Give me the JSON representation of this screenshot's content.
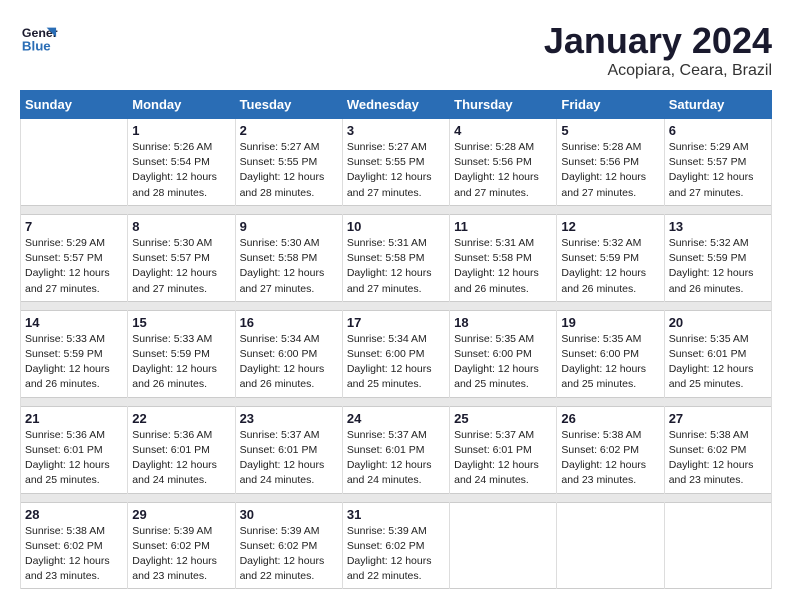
{
  "header": {
    "logo_line1": "General",
    "logo_line2": "Blue",
    "main_title": "January 2024",
    "subtitle": "Acopiara, Ceara, Brazil"
  },
  "days_of_week": [
    "Sunday",
    "Monday",
    "Tuesday",
    "Wednesday",
    "Thursday",
    "Friday",
    "Saturday"
  ],
  "weeks": [
    [
      {
        "day": "",
        "info": ""
      },
      {
        "day": "1",
        "info": "Sunrise: 5:26 AM\nSunset: 5:54 PM\nDaylight: 12 hours\nand 28 minutes."
      },
      {
        "day": "2",
        "info": "Sunrise: 5:27 AM\nSunset: 5:55 PM\nDaylight: 12 hours\nand 28 minutes."
      },
      {
        "day": "3",
        "info": "Sunrise: 5:27 AM\nSunset: 5:55 PM\nDaylight: 12 hours\nand 27 minutes."
      },
      {
        "day": "4",
        "info": "Sunrise: 5:28 AM\nSunset: 5:56 PM\nDaylight: 12 hours\nand 27 minutes."
      },
      {
        "day": "5",
        "info": "Sunrise: 5:28 AM\nSunset: 5:56 PM\nDaylight: 12 hours\nand 27 minutes."
      },
      {
        "day": "6",
        "info": "Sunrise: 5:29 AM\nSunset: 5:57 PM\nDaylight: 12 hours\nand 27 minutes."
      }
    ],
    [
      {
        "day": "7",
        "info": "Sunrise: 5:29 AM\nSunset: 5:57 PM\nDaylight: 12 hours\nand 27 minutes."
      },
      {
        "day": "8",
        "info": "Sunrise: 5:30 AM\nSunset: 5:57 PM\nDaylight: 12 hours\nand 27 minutes."
      },
      {
        "day": "9",
        "info": "Sunrise: 5:30 AM\nSunset: 5:58 PM\nDaylight: 12 hours\nand 27 minutes."
      },
      {
        "day": "10",
        "info": "Sunrise: 5:31 AM\nSunset: 5:58 PM\nDaylight: 12 hours\nand 27 minutes."
      },
      {
        "day": "11",
        "info": "Sunrise: 5:31 AM\nSunset: 5:58 PM\nDaylight: 12 hours\nand 26 minutes."
      },
      {
        "day": "12",
        "info": "Sunrise: 5:32 AM\nSunset: 5:59 PM\nDaylight: 12 hours\nand 26 minutes."
      },
      {
        "day": "13",
        "info": "Sunrise: 5:32 AM\nSunset: 5:59 PM\nDaylight: 12 hours\nand 26 minutes."
      }
    ],
    [
      {
        "day": "14",
        "info": "Sunrise: 5:33 AM\nSunset: 5:59 PM\nDaylight: 12 hours\nand 26 minutes."
      },
      {
        "day": "15",
        "info": "Sunrise: 5:33 AM\nSunset: 5:59 PM\nDaylight: 12 hours\nand 26 minutes."
      },
      {
        "day": "16",
        "info": "Sunrise: 5:34 AM\nSunset: 6:00 PM\nDaylight: 12 hours\nand 26 minutes."
      },
      {
        "day": "17",
        "info": "Sunrise: 5:34 AM\nSunset: 6:00 PM\nDaylight: 12 hours\nand 25 minutes."
      },
      {
        "day": "18",
        "info": "Sunrise: 5:35 AM\nSunset: 6:00 PM\nDaylight: 12 hours\nand 25 minutes."
      },
      {
        "day": "19",
        "info": "Sunrise: 5:35 AM\nSunset: 6:00 PM\nDaylight: 12 hours\nand 25 minutes."
      },
      {
        "day": "20",
        "info": "Sunrise: 5:35 AM\nSunset: 6:01 PM\nDaylight: 12 hours\nand 25 minutes."
      }
    ],
    [
      {
        "day": "21",
        "info": "Sunrise: 5:36 AM\nSunset: 6:01 PM\nDaylight: 12 hours\nand 25 minutes."
      },
      {
        "day": "22",
        "info": "Sunrise: 5:36 AM\nSunset: 6:01 PM\nDaylight: 12 hours\nand 24 minutes."
      },
      {
        "day": "23",
        "info": "Sunrise: 5:37 AM\nSunset: 6:01 PM\nDaylight: 12 hours\nand 24 minutes."
      },
      {
        "day": "24",
        "info": "Sunrise: 5:37 AM\nSunset: 6:01 PM\nDaylight: 12 hours\nand 24 minutes."
      },
      {
        "day": "25",
        "info": "Sunrise: 5:37 AM\nSunset: 6:01 PM\nDaylight: 12 hours\nand 24 minutes."
      },
      {
        "day": "26",
        "info": "Sunrise: 5:38 AM\nSunset: 6:02 PM\nDaylight: 12 hours\nand 23 minutes."
      },
      {
        "day": "27",
        "info": "Sunrise: 5:38 AM\nSunset: 6:02 PM\nDaylight: 12 hours\nand 23 minutes."
      }
    ],
    [
      {
        "day": "28",
        "info": "Sunrise: 5:38 AM\nSunset: 6:02 PM\nDaylight: 12 hours\nand 23 minutes."
      },
      {
        "day": "29",
        "info": "Sunrise: 5:39 AM\nSunset: 6:02 PM\nDaylight: 12 hours\nand 23 minutes."
      },
      {
        "day": "30",
        "info": "Sunrise: 5:39 AM\nSunset: 6:02 PM\nDaylight: 12 hours\nand 22 minutes."
      },
      {
        "day": "31",
        "info": "Sunrise: 5:39 AM\nSunset: 6:02 PM\nDaylight: 12 hours\nand 22 minutes."
      },
      {
        "day": "",
        "info": ""
      },
      {
        "day": "",
        "info": ""
      },
      {
        "day": "",
        "info": ""
      }
    ]
  ]
}
